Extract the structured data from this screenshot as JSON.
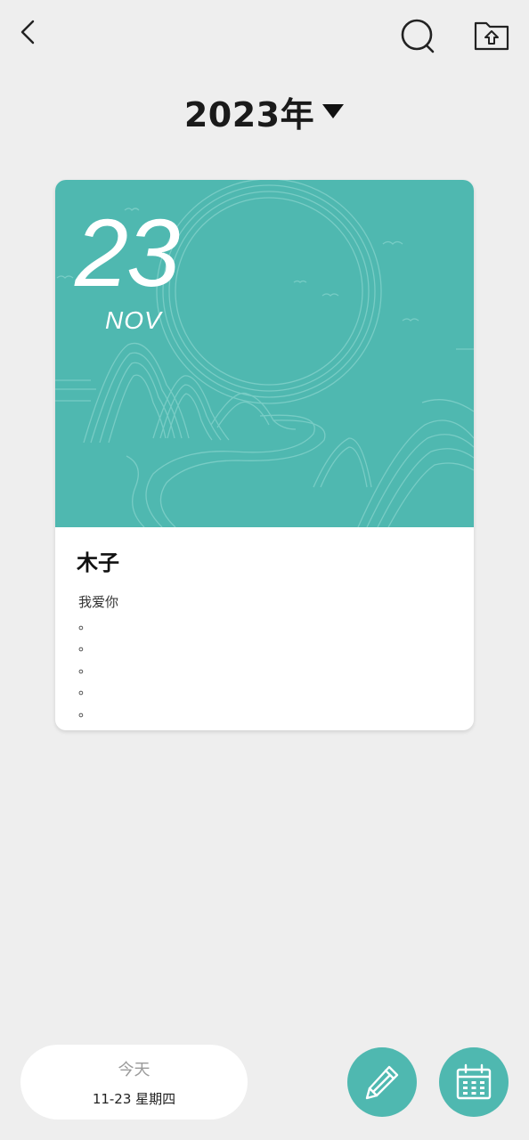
{
  "header": {
    "back_icon": "chevron-left-icon",
    "search_icon": "search-icon",
    "upload_icon": "folder-upload-icon"
  },
  "year_selector": {
    "label": "2023年",
    "dropdown_icon": "triangle-down-icon"
  },
  "entry_card": {
    "day": "23",
    "month": "NOV",
    "cover_color": "#4fb8b0",
    "title": "木子",
    "body_lines": [
      "我爱你",
      "。",
      "。",
      "。",
      "。",
      "。"
    ]
  },
  "bottom_bar": {
    "today_label": "今天",
    "today_date": "11-23 星期四",
    "edit_icon": "pencil-icon",
    "calendar_icon": "calendar-icon",
    "accent_color": "#4fb8b0"
  }
}
